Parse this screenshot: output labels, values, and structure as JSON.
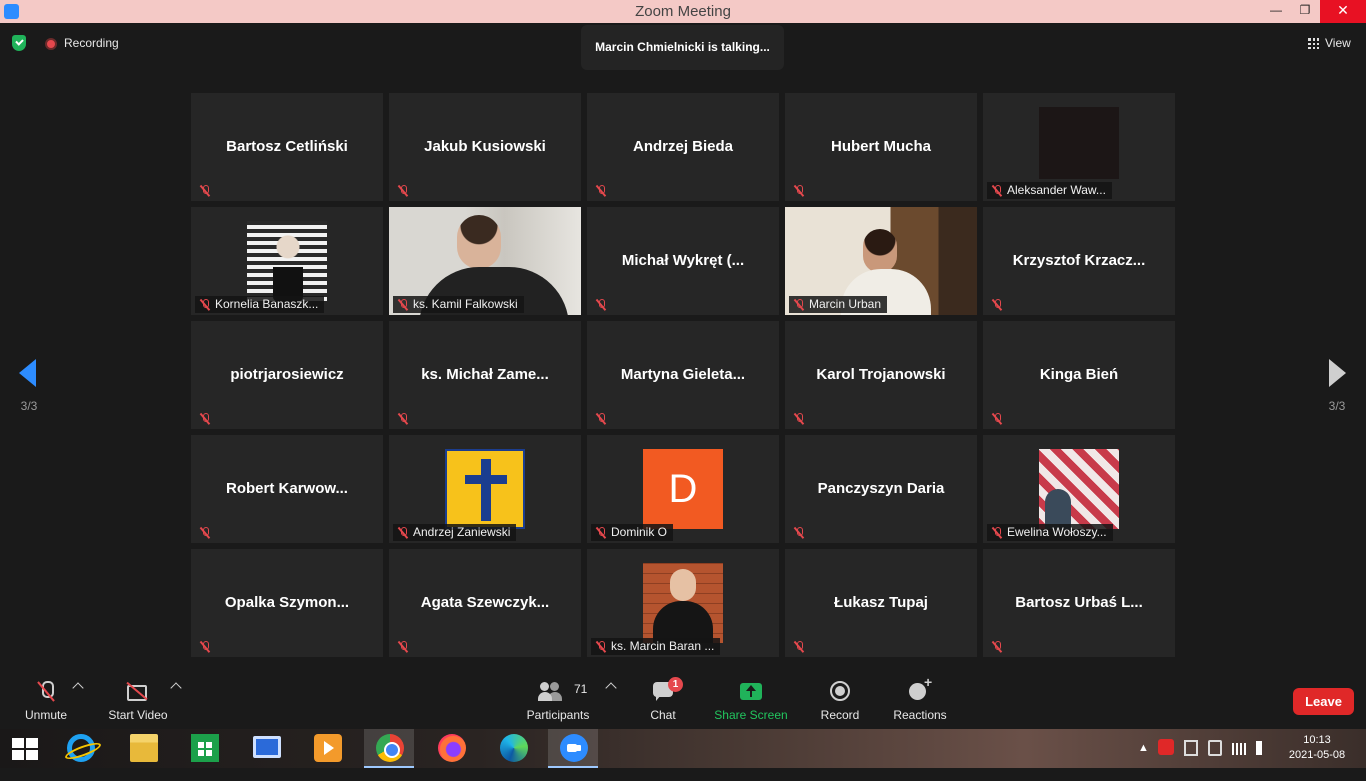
{
  "window": {
    "title": "Zoom Meeting",
    "minimize": "—",
    "maximize": "❐",
    "close": "✕"
  },
  "status": {
    "recording": "Recording",
    "talking": "Marcin Chmielnicki is talking...",
    "view": "View"
  },
  "pagination": {
    "left_page": "3/3",
    "right_page": "3/3"
  },
  "participants_grid": [
    {
      "name": "Bartosz Cetliński",
      "display": "name"
    },
    {
      "name": "Jakub Kusiowski",
      "display": "name"
    },
    {
      "name": "Andrzej Bieda",
      "display": "name"
    },
    {
      "name": "Hubert Mucha",
      "display": "name"
    },
    {
      "name": "Aleksander Waw...",
      "display": "avatar"
    },
    {
      "name": "Kornelia Banaszk...",
      "display": "avatar"
    },
    {
      "name": "ks. Kamil Falkowski",
      "display": "video"
    },
    {
      "name": "Michał Wykręt (...",
      "display": "name"
    },
    {
      "name": "Marcin Urban",
      "display": "video"
    },
    {
      "name": "Krzysztof Krzacz...",
      "display": "name"
    },
    {
      "name": "piotrjarosiewicz",
      "display": "name"
    },
    {
      "name": "ks. Michał Zame...",
      "display": "name"
    },
    {
      "name": "Martyna Gieleta...",
      "display": "name"
    },
    {
      "name": "Karol Trojanowski",
      "display": "name"
    },
    {
      "name": "Kinga Bień",
      "display": "name"
    },
    {
      "name": "Robert Karwow...",
      "display": "name"
    },
    {
      "name": "Andrzej Zaniewski",
      "display": "avatar"
    },
    {
      "name": "Dominik O",
      "display": "initial",
      "initial": "D"
    },
    {
      "name": "Panczyszyn Daria",
      "display": "name"
    },
    {
      "name": "Ewelina Wołoszy...",
      "display": "avatar"
    },
    {
      "name": "Opalka Szymon...",
      "display": "name"
    },
    {
      "name": "Agata Szewczyk...",
      "display": "name"
    },
    {
      "name": "ks. Marcin Baran ...",
      "display": "avatar"
    },
    {
      "name": "Łukasz Tupaj",
      "display": "name"
    },
    {
      "name": "Bartosz Urbaś L...",
      "display": "name"
    }
  ],
  "toolbar": {
    "unmute": "Unmute",
    "start_video": "Start Video",
    "participants": "Participants",
    "participants_count": "71",
    "chat": "Chat",
    "chat_badge": "1",
    "share_screen": "Share Screen",
    "record": "Record",
    "reactions": "Reactions",
    "leave": "Leave"
  },
  "taskbar": {
    "time": "10:13",
    "date": "2021-05-08"
  },
  "colors": {
    "zoom_blue": "#2d8cff",
    "share_green": "#22c55e",
    "leave_red": "#e02828",
    "muted_red": "#e5484d",
    "tile_bg": "#262626"
  }
}
